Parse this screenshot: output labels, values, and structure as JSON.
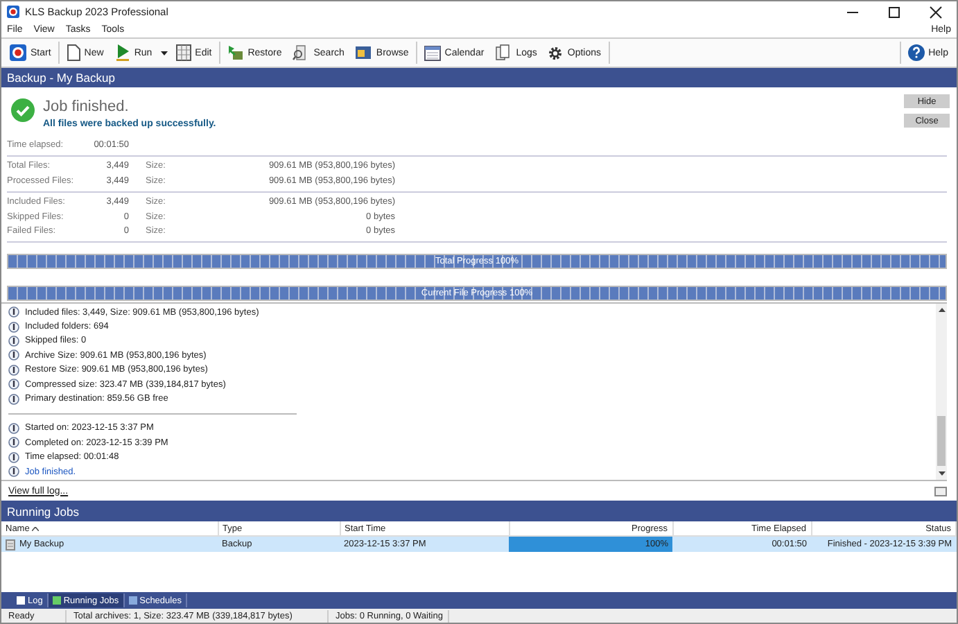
{
  "window": {
    "title": "KLS Backup 2023 Professional"
  },
  "menu": [
    "File",
    "View",
    "Tasks",
    "Tools"
  ],
  "menu_right": "Help",
  "toolbar": [
    {
      "label": "Start",
      "kind": "start"
    },
    {
      "label": "New",
      "kind": "new"
    },
    {
      "label": "Run",
      "kind": "run"
    },
    {
      "label": "Edit",
      "kind": "edit"
    },
    {
      "label": "Restore",
      "kind": "restore"
    },
    {
      "label": "Search",
      "kind": "search"
    },
    {
      "label": "Browse",
      "kind": "browse"
    },
    {
      "label": "Calendar",
      "kind": "calendar"
    },
    {
      "label": "Logs",
      "kind": "logs"
    },
    {
      "label": "Options",
      "kind": "options"
    }
  ],
  "toolbar_help": "Help",
  "job_panel": {
    "header": "Backup - My Backup",
    "title": "Job finished.",
    "subtitle": "All files were backed up successfully.",
    "buttons": [
      "Hide",
      "Close"
    ],
    "stat_groups": [
      [
        {
          "label": "Time elapsed:",
          "value": "00:01:50"
        }
      ],
      [
        {
          "label": "Total Files:",
          "value": "3,449",
          "size_label": "Size:",
          "size": "909.61 MB (953,800,196 bytes)"
        },
        {
          "label": "Processed Files:",
          "value": "3,449",
          "size_label": "Size:",
          "size": "909.61 MB (953,800,196 bytes)"
        }
      ],
      [
        {
          "label": "Included Files:",
          "value": "3,449",
          "size_label": "Size:",
          "size": "909.61 MB (953,800,196 bytes)"
        },
        {
          "label": "Skipped Files:",
          "value": "0",
          "size_label": "Size:",
          "size": "0 bytes"
        },
        {
          "label": "Failed Files:",
          "value": "0",
          "size_label": "Size:",
          "size": "0 bytes"
        }
      ]
    ],
    "progress": [
      {
        "label": "Total Progress 100%",
        "level": 1
      },
      {
        "label": "Current File Progress 100%",
        "level": 1
      }
    ],
    "log_groups": [
      [
        {
          "text": "Included files: 3,449, Size: 909.61 MB (953,800,196 bytes)",
          "kind": "info"
        },
        {
          "text": "Included folders: 694",
          "kind": "info"
        },
        {
          "text": "Skipped files: 0",
          "kind": "info"
        },
        {
          "text": "Archive Size: 909.61 MB (953,800,196 bytes)",
          "kind": "info"
        },
        {
          "text": "Restore Size: 909.61 MB (953,800,196 bytes)",
          "kind": "info"
        },
        {
          "text": "Compressed size: 323.47 MB (339,184,817 bytes)",
          "kind": "info"
        },
        {
          "text": "Primary destination: 859.56 GB free",
          "kind": "info"
        }
      ],
      [
        {
          "text": "Started on: 2023-12-15 3:37 PM",
          "kind": "info"
        },
        {
          "text": "Completed on: 2023-12-15 3:39 PM",
          "kind": "info"
        },
        {
          "text": "Time elapsed: 00:01:48",
          "kind": "info"
        },
        {
          "text": "Job finished.",
          "kind": "highlight"
        }
      ]
    ],
    "view_log": "View full log..."
  },
  "running_jobs": {
    "header": "Running Jobs",
    "columns": [
      {
        "label": "Name",
        "sorted": true
      },
      {
        "label": "Type",
        "sorted": false
      },
      {
        "label": "Start Time",
        "sorted": false
      },
      {
        "label": "Progress",
        "sorted": false
      },
      {
        "label": "Time Elapsed",
        "sorted": false
      },
      {
        "label": "Status",
        "sorted": false
      }
    ],
    "rows": [
      {
        "name": "My Backup",
        "type": "Backup",
        "start_time": "2023-12-15 3:37 PM",
        "progress": "100%",
        "level": 1,
        "elapsed": "00:01:50",
        "status": "Finished - 2023-12-15 3:39 PM",
        "selected": true
      }
    ]
  },
  "bottom_tabs": [
    {
      "label": "Log",
      "selected": false
    },
    {
      "label": "Running Jobs",
      "selected": true
    },
    {
      "label": "Schedules",
      "selected": false
    }
  ],
  "status_bar": [
    "Ready",
    "Total archives: 1, Size: 323.47 MB (339,184,817 bytes)",
    "Jobs: 0 Running, 0 Waiting"
  ]
}
